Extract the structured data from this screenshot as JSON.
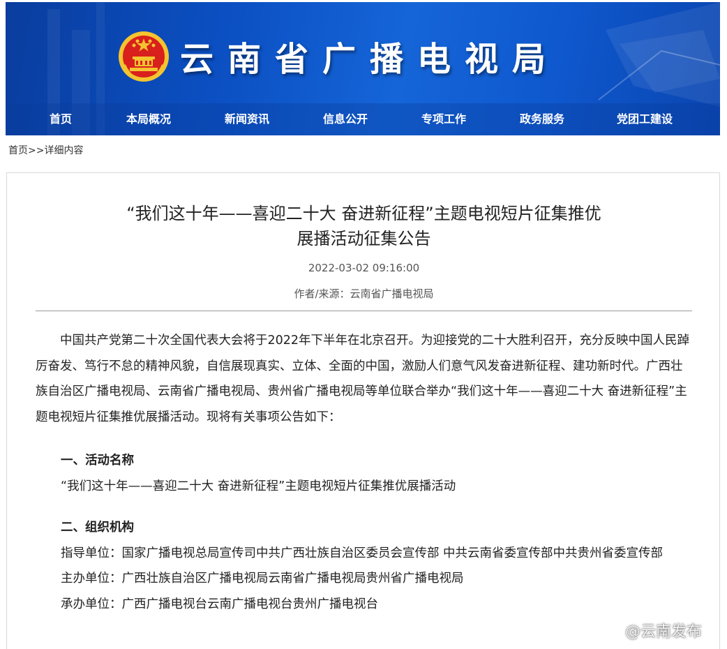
{
  "header": {
    "site_title": "云南省广播电视局",
    "nav": [
      "首页",
      "本局概况",
      "新闻资讯",
      "信息公开",
      "专项工作",
      "政务服务",
      "党团工建设"
    ]
  },
  "breadcrumb": {
    "home": "首页",
    "sep": ">>",
    "current": "详细内容"
  },
  "article": {
    "title_line1": "“我们这十年——喜迎二十大 奋进新征程”主题电视短片征集推优",
    "title_line2": "展播活动征集公告",
    "date": "2022-03-02 09:16:00",
    "source": "作者/来源：云南省广播电视局",
    "intro": "中国共产党第二十次全国代表大会将于2022年下半年在北京召开。为迎接党的二十大胜利召开，充分反映中国人民踔厉奋发、笃行不怠的精神风貌，自信展现真实、立体、全面的中国，激励人们意气风发奋进新征程、建功新时代。广西壮族自治区广播电视局、云南省广播电视局、贵州省广播电视局等单位联合举办“我们这十年——喜迎二十大 奋进新征程”主题电视短片征集推优展播活动。现将有关事项公告如下：",
    "section1_heading": "一、活动名称",
    "section1_text": "“我们这十年——喜迎二十大 奋进新征程”主题电视短片征集推优展播活动",
    "section2_heading": "二、组织机构",
    "guide_unit": "指导单位：国家广播电视总局宣传司中共广西壮族自治区委员会宣传部 中共云南省委宣传部中共贵州省委宣传部",
    "host_unit": "主办单位：广西壮族自治区广播电视局云南省广播电视局贵州省广播电视局",
    "organizer_unit": "承办单位：广西广播电视台云南广播电视台贵州广播电视台"
  },
  "watermark": {
    "text": "@云南发布",
    "icon": "weibo-icon"
  },
  "colors": {
    "banner_blue": "#0b4fc2",
    "nav_text": "#ffffff",
    "emblem_red": "#d8201c",
    "emblem_gold": "#f4c430"
  }
}
